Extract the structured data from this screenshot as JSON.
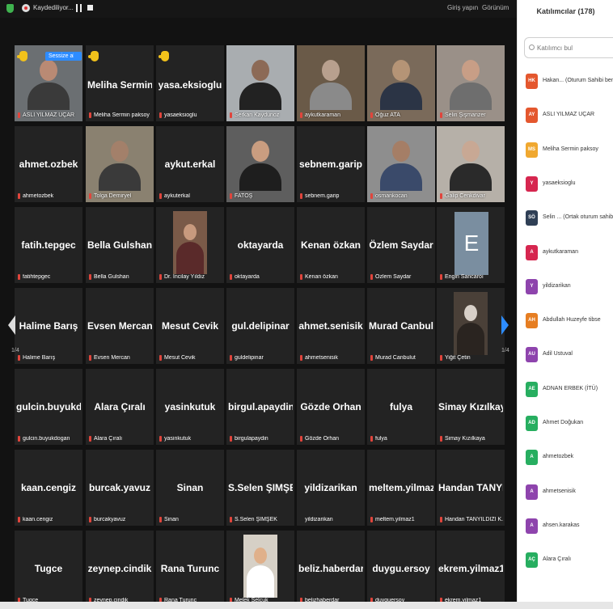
{
  "toolbar": {
    "recording_label": "Kaydediliyor...",
    "gallery_label": "Giriş yapın",
    "view_label": "Görünüm"
  },
  "colors": {
    "accent": "#2d8cff",
    "mute": "#e0453c",
    "hand": "#f2c21b",
    "highlight": "#c9cc3a"
  },
  "self_tile": {
    "button_label": "Sessize al"
  },
  "tiles": [
    {
      "name": "",
      "label": "ASLI YILMAZ UÇAR",
      "type": "video",
      "hand": true,
      "highlight": true,
      "bg": "#6b6f72",
      "skin": "#b98a74",
      "shirt": "#3a3a3a",
      "mute": false
    },
    {
      "name": "Meliha  Sermin...",
      "label": "Meliha Sermin paksoy",
      "type": "name",
      "hand": true
    },
    {
      "name": "yasa.eksioglu",
      "label": "yasaeksioglu",
      "type": "name",
      "hand": true
    },
    {
      "name": "",
      "label": "Serkan Kaydunoz",
      "type": "video",
      "bg": "#a9adb0",
      "skin": "#8c6a56",
      "shirt": "#222"
    },
    {
      "name": "",
      "label": "aykutkaraman",
      "type": "video",
      "bg": "#6a5a48",
      "skin": "#b8a08e",
      "shirt": "#8a8a8a"
    },
    {
      "name": "",
      "label": "Oğuz ATA",
      "type": "video",
      "bg": "#7a6a5a",
      "skin": "#b59476",
      "shirt": "#2b3445"
    },
    {
      "name": "",
      "label": "Selin Şişmanzer",
      "type": "video",
      "bg": "#9a9088",
      "skin": "#c89e86",
      "shirt": "#6e6e6e"
    },
    {
      "name": "ahmet.ozbek",
      "label": "ahmetozbek",
      "type": "name"
    },
    {
      "name": "",
      "label": "Tolga Demiryel",
      "type": "video",
      "bg": "#8a8170",
      "skin": "#a3806a",
      "shirt": "#3a3a3a"
    },
    {
      "name": "aykut.erkal",
      "label": "aykuterkal",
      "type": "name"
    },
    {
      "name": "",
      "label": "FATOŞ",
      "type": "video",
      "bg": "#5e5e5e",
      "skin": "#c99d80",
      "shirt": "#1e1e1e"
    },
    {
      "name": "sebnem.garip",
      "label": "sebnem.garip",
      "type": "name"
    },
    {
      "name": "",
      "label": "osmankocan",
      "type": "video",
      "bg": "#8e8e8e",
      "skin": "#a57e66",
      "shirt": "#3a4a6a"
    },
    {
      "name": "",
      "label": "Galip Cenkdivar",
      "type": "video",
      "bg": "#b6b0a8",
      "skin": "#c8a894",
      "shirt": "#2a2a2a"
    },
    {
      "name": "fatih.tepgec",
      "label": "fatihtepgec",
      "type": "name"
    },
    {
      "name": "Bella Gulshan",
      "label": "Bella Gulshan",
      "type": "name"
    },
    {
      "name": "",
      "label": "Dr. Incilay Yıldız",
      "type": "small",
      "bg": "#7a5a48",
      "skin": "#c89a7e",
      "shirt": "#5a2a2a"
    },
    {
      "name": "oktayarda",
      "label": "oktayarda",
      "type": "name"
    },
    {
      "name": "Kenan özkan",
      "label": "Kenan özkan",
      "type": "name"
    },
    {
      "name": "Özlem Saydar",
      "label": "Özlem Saydar",
      "type": "name"
    },
    {
      "name": "E",
      "label": "Engin Sancaroı",
      "type": "letter"
    },
    {
      "name": "Halime Barış",
      "label": "Halime Barış",
      "type": "name"
    },
    {
      "name": "Evsen Mercan",
      "label": "Evsen Mercan",
      "type": "name"
    },
    {
      "name": "Mesut Cevik",
      "label": "Mesut Cevik",
      "type": "name"
    },
    {
      "name": "gul.delipinar",
      "label": "guldelipinar",
      "type": "name"
    },
    {
      "name": "ahmet.senisik",
      "label": "ahmetsenisik",
      "type": "name"
    },
    {
      "name": "Murad Canbulut",
      "label": "Murad Canbulut",
      "type": "name"
    },
    {
      "name": "",
      "label": "Yiğit Çetin",
      "type": "small",
      "bg": "#4a4038",
      "skin": "#d8d0c8",
      "shirt": "#2a2420"
    },
    {
      "name": "gulcin.buyukdo...",
      "label": "gulcin.buyukdogan",
      "type": "name"
    },
    {
      "name": "Alara Çıralı",
      "label": "Alara Çıralı",
      "type": "name"
    },
    {
      "name": "yasinkutuk",
      "label": "yasinkutuk",
      "type": "name"
    },
    {
      "name": "birgul.apaydin",
      "label": "birgulapaydin",
      "type": "name"
    },
    {
      "name": "Gözde Orhan",
      "label": "Gözde Orhan",
      "type": "name"
    },
    {
      "name": "fulya",
      "label": "fulya",
      "type": "name"
    },
    {
      "name": "Simay Kızılkaya",
      "label": "Simay Kızılkaya",
      "type": "name"
    },
    {
      "name": "kaan.cengiz",
      "label": "kaan.cengiz",
      "type": "name"
    },
    {
      "name": "burcak.yavuz",
      "label": "burcakyavuz",
      "type": "name"
    },
    {
      "name": "Sinan",
      "label": "Sinan",
      "type": "name"
    },
    {
      "name": "S.Selen ŞIMŞEK",
      "label": "S.Selen ŞIMŞEK",
      "type": "name"
    },
    {
      "name": "yildizarikan",
      "label": "yildizarikan",
      "type": "name",
      "nomute": true
    },
    {
      "name": "meltem.yilmaz1",
      "label": "meltem.yilmaz1",
      "type": "name"
    },
    {
      "name": "Handan  TANYIL...",
      "label": "Handan TANYILDIZI K...",
      "type": "name"
    },
    {
      "name": "Tugce",
      "label": "Tugce",
      "type": "name"
    },
    {
      "name": "zeynep.cindik",
      "label": "zeynep.cindik",
      "type": "name"
    },
    {
      "name": "Rana Turunc",
      "label": "Rana Turunc",
      "type": "name"
    },
    {
      "name": "",
      "label": "Melek Selcuk",
      "type": "small",
      "bg": "#d6d0c6",
      "skin": "#e0b08a",
      "shirt": "#ffffff"
    },
    {
      "name": "beliz.haberdar",
      "label": "belizhaberdar",
      "type": "name"
    },
    {
      "name": "duygu.ersoy",
      "label": "duyguersoy",
      "type": "name"
    },
    {
      "name": "ekrem.yilmaz1",
      "label": "ekrem.yilmaz1",
      "type": "name"
    }
  ],
  "pagination": {
    "left": "1/4",
    "right": "1/4"
  },
  "panel": {
    "title": "Katılımcılar (178)",
    "search_placeholder": "Katılımcı bul",
    "participants": [
      {
        "initials": "HK",
        "name": "Hakan... (Oturum Sahibi ben)",
        "color": "#e4572e"
      },
      {
        "initials": "AY",
        "name": "ASLI YILMAZ UÇAR",
        "color": "#e4572e"
      },
      {
        "initials": "MS",
        "name": "Meliha Sermin paksoy",
        "color": "#f0a830"
      },
      {
        "initials": "Y",
        "name": "yasaeksioglu",
        "color": "#d6264f"
      },
      {
        "initials": "SÖ",
        "name": "Selin ... (Ortak oturum sahibi)",
        "color": "#2f3f55"
      },
      {
        "initials": "A",
        "name": "aykutkaraman",
        "color": "#d6264f"
      },
      {
        "initials": "Y",
        "name": "yildizarikan",
        "color": "#8e44ad"
      },
      {
        "initials": "AH",
        "name": "Abdullah Huzeyfe tibse",
        "color": "#e67e22"
      },
      {
        "initials": "AU",
        "name": "Adil Ustuval",
        "color": "#8e44ad"
      },
      {
        "initials": "AE",
        "name": "ADNAN ERBEK (İTÜ)",
        "color": "#27ae60"
      },
      {
        "initials": "AD",
        "name": "Ahmet Doğukan",
        "color": "#27ae60"
      },
      {
        "initials": "A",
        "name": "ahmetozbek",
        "color": "#27ae60"
      },
      {
        "initials": "A",
        "name": "ahmetsenisik",
        "color": "#8e44ad"
      },
      {
        "initials": "A",
        "name": "ahsen.karakas",
        "color": "#8e44ad"
      },
      {
        "initials": "AÇ",
        "name": "Alara Çıralı",
        "color": "#27ae60"
      }
    ]
  }
}
